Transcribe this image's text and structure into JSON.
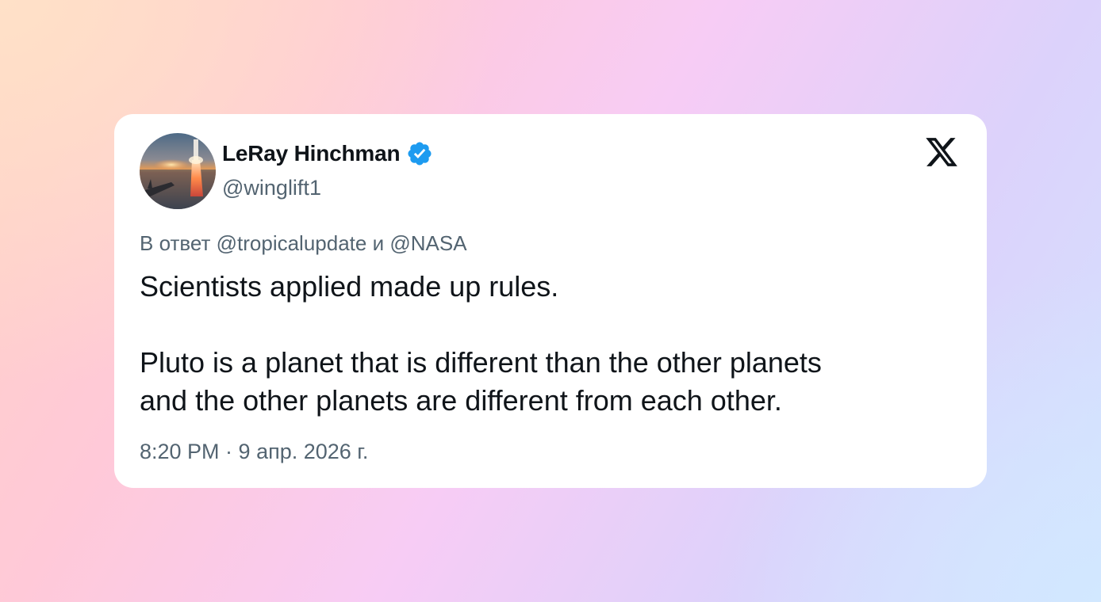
{
  "tweet": {
    "author": {
      "display_name": "LeRay Hinchman",
      "handle": "@winglift1",
      "verified": true,
      "avatar": "rocket-launch-sunset-photo"
    },
    "reply_to": {
      "prefix": "В ответ",
      "first": "@tropicalupdate",
      "conjunction": "и",
      "second": "@NASA"
    },
    "text": {
      "paragraph_1": "Scientists applied made up rules.",
      "paragraph_2_line_1": "Pluto is a planet that is different than the other planets",
      "paragraph_2_line_2": "and the other planets are different from each other."
    },
    "timestamp": "8:20 PM · 9 апр. 2026 г."
  },
  "icons": {
    "platform_logo": "x-logo-icon",
    "verified_badge": "verified-badge-icon"
  },
  "colors": {
    "verified_blue": "#1d9bf0",
    "text_primary": "#0f1419",
    "text_secondary": "#536471"
  }
}
